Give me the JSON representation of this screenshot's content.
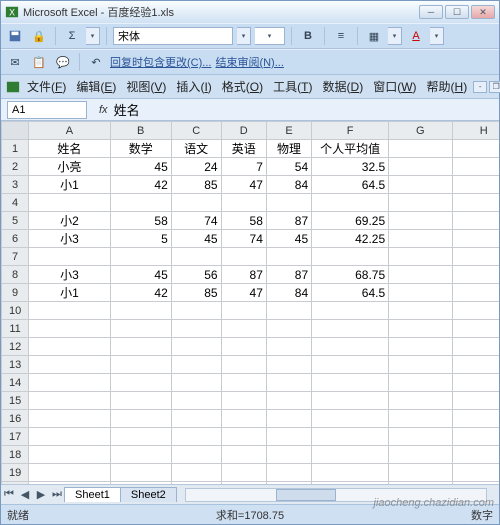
{
  "titlebar": {
    "app": "Microsoft Excel",
    "doc": "百度经验1.xls"
  },
  "toolbar1": {
    "font": "宋体"
  },
  "toolbar2": {
    "reply_link": "回复时包含更改(C)...",
    "end_review": "结束审阅(N)..."
  },
  "menu": {
    "file": "文件",
    "file_u": "F",
    "edit": "编辑",
    "edit_u": "E",
    "view": "视图",
    "view_u": "V",
    "insert": "插入",
    "insert_u": "I",
    "format": "格式",
    "format_u": "O",
    "tools": "工具",
    "tools_u": "T",
    "data": "数据",
    "data_u": "D",
    "window": "窗口",
    "window_u": "W",
    "help": "帮助",
    "help_u": "H"
  },
  "formula": {
    "namebox": "A1",
    "fx_label": "fx",
    "value": "姓名"
  },
  "columns": [
    "A",
    "B",
    "C",
    "D",
    "E",
    "F",
    "G",
    "H"
  ],
  "row_count": 21,
  "header_row": [
    "姓名",
    "数学",
    "语文",
    "英语",
    "物理",
    "个人平均值"
  ],
  "rows": [
    [
      "小亮",
      45,
      24,
      7,
      54,
      32.5
    ],
    [
      "小1",
      42,
      85,
      47,
      84,
      64.5
    ],
    null,
    [
      "小2",
      58,
      74,
      58,
      87,
      69.25
    ],
    [
      "小3",
      5,
      45,
      74,
      45,
      42.25
    ],
    null,
    [
      "小3",
      45,
      56,
      87,
      87,
      68.75
    ],
    [
      "小1",
      42,
      85,
      47,
      84,
      64.5
    ]
  ],
  "tabs": {
    "t1": "Sheet1",
    "t2": "Sheet2"
  },
  "status": {
    "left": "就绪",
    "sum": "求和=1708.75",
    "mode": "数字"
  },
  "watermark": "jiaocheng.chazidian.com"
}
